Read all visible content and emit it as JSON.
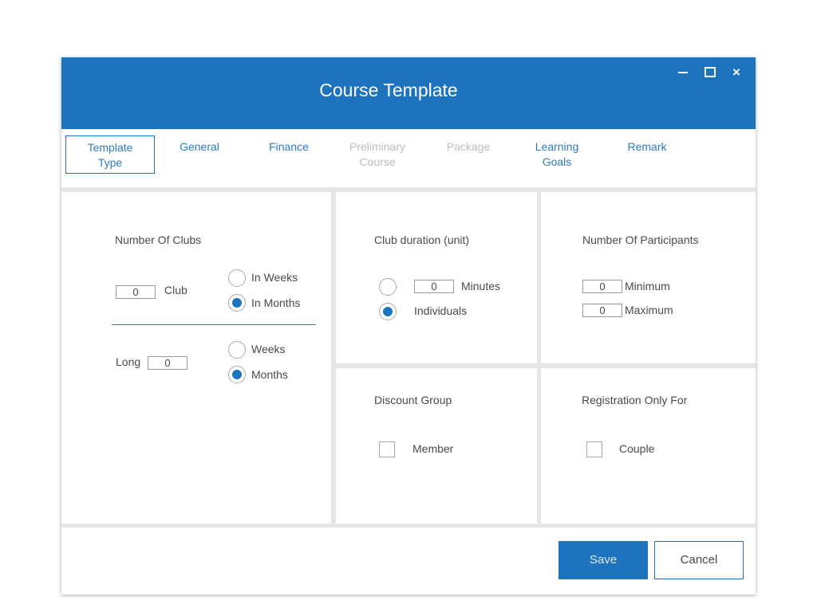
{
  "window": {
    "title": "Course Template",
    "controls": {
      "minimize": "minimize-icon",
      "maximize": "maximize-icon",
      "close": "×"
    }
  },
  "tabs": [
    {
      "label": "Template Type",
      "state": "active"
    },
    {
      "label": "General",
      "state": "enabled"
    },
    {
      "label": "Finance",
      "state": "enabled"
    },
    {
      "label": "Preliminary Course",
      "state": "disabled"
    },
    {
      "label": "Package",
      "state": "disabled"
    },
    {
      "label": "Learning Goals",
      "state": "enabled"
    },
    {
      "label": "Remark",
      "state": "enabled"
    }
  ],
  "clubs": {
    "heading": "Number Of Clubs",
    "count_value": "0",
    "count_unit": "Club",
    "period_options": [
      {
        "label": "In Weeks",
        "checked": false
      },
      {
        "label": "In Months",
        "checked": true
      }
    ],
    "long_label": "Long",
    "long_value": "0",
    "long_options": [
      {
        "label": "Weeks",
        "checked": false
      },
      {
        "label": "Months",
        "checked": true
      }
    ]
  },
  "duration": {
    "heading": "Club duration (unit)",
    "minutes_value": "0",
    "minutes_label": "Minutes",
    "individuals_label": "Individuals",
    "minutes_checked": false,
    "individuals_checked": true
  },
  "participants": {
    "heading": "Number Of Participants",
    "minimum_value": "0",
    "minimum_label": "Minimum",
    "maximum_value": "0",
    "maximum_label": "Maximum"
  },
  "discount": {
    "heading": "Discount Group",
    "option_label": "Member",
    "checked": false
  },
  "registration": {
    "heading": "Registration Only For",
    "option_label": "Couple",
    "checked": false
  },
  "footer": {
    "save_label": "Save",
    "cancel_label": "Cancel"
  },
  "colors": {
    "accent": "#1e73be",
    "tab_text": "#2d7cc1",
    "tab_disabled": "#bdbdbd",
    "background": "#e6e6e6"
  }
}
